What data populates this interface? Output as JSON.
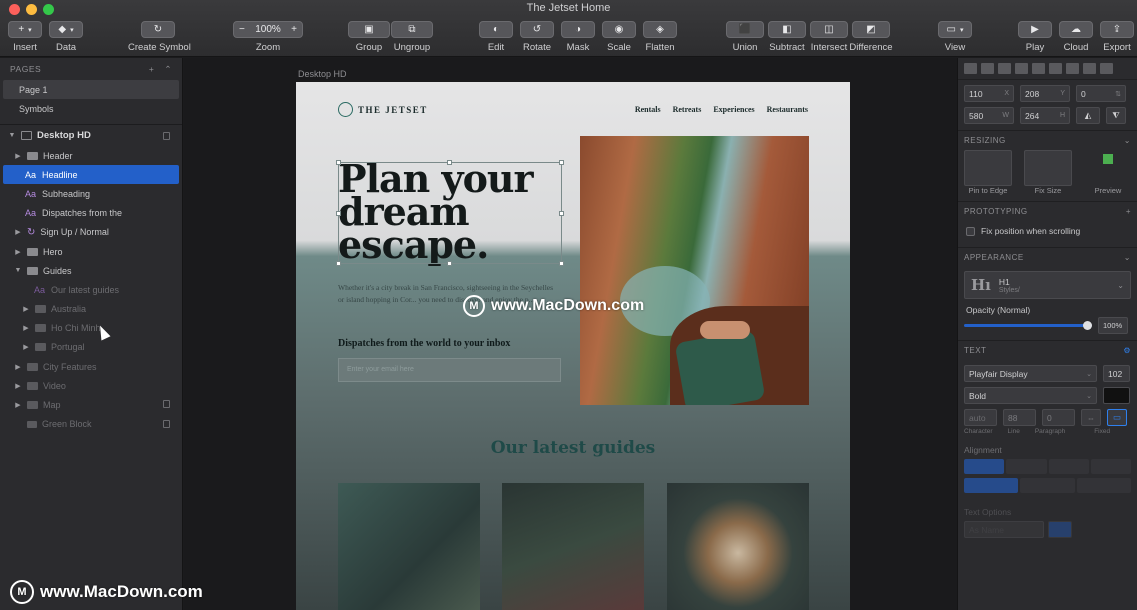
{
  "window": {
    "title": "The Jetset Home"
  },
  "toolbar": {
    "insert": "Insert",
    "data": "Data",
    "create_symbol": "Create Symbol",
    "zoom": "Zoom",
    "zoom_value": "100%",
    "zoom_minus": "−",
    "zoom_plus": "+",
    "group": "Group",
    "ungroup": "Ungroup",
    "edit": "Edit",
    "rotate": "Rotate",
    "mask": "Mask",
    "scale": "Scale",
    "flatten": "Flatten",
    "union": "Union",
    "subtract": "Subtract",
    "intersect": "Intersect",
    "difference": "Difference",
    "view": "View",
    "play": "Play",
    "cloud": "Cloud",
    "export": "Export"
  },
  "pages": {
    "heading": "PAGES",
    "items": [
      "Page 1",
      "Symbols"
    ]
  },
  "layers": {
    "artboard": "Desktop HD",
    "items": [
      {
        "label": "Header"
      },
      {
        "label": "Headline"
      },
      {
        "label": "Subheading"
      },
      {
        "label": "Dispatches from the"
      },
      {
        "label": "Sign Up / Normal"
      },
      {
        "label": "Hero"
      },
      {
        "label": "Guides"
      },
      {
        "label": "Our latest guides"
      },
      {
        "label": "Australia"
      },
      {
        "label": "Ho Chi Minh"
      },
      {
        "label": "Portugal"
      },
      {
        "label": "City Features"
      },
      {
        "label": "Video"
      },
      {
        "label": "Map"
      },
      {
        "label": "Green Block"
      }
    ]
  },
  "canvas": {
    "artboard_label": "Desktop HD",
    "logo": "THE JETSET",
    "nav": [
      "Rentals",
      "Retreats",
      "Experiences",
      "Restaurants"
    ],
    "headline": "Plan your dream escape.",
    "subheading": "Whether it's a city break in San Francisco, sightseeing in the Seychelles or island hopping in Cor... you need to discover and enjoy the p...",
    "dispatch": "Dispatches from the world to your inbox",
    "email_placeholder": "Enter your email here",
    "guides_title": "Our latest guides"
  },
  "watermark": {
    "text": "www.MacDown.com",
    "letter": "M"
  },
  "inspector": {
    "x": "110",
    "x_unit": "X",
    "y": "208",
    "y_unit": "Y",
    "rot": "0",
    "w": "580",
    "w_unit": "W",
    "h": "264",
    "h_unit": "H",
    "resizing": "RESIZING",
    "pin_to_edge": "Pin to Edge",
    "fix_size": "Fix Size",
    "preview": "Preview",
    "prototyping": "PROTOTYPING",
    "fix_position": "Fix position when scrolling",
    "appearance": "APPEARANCE",
    "style_name": "H1",
    "style_sub": "Styles/",
    "opacity_label": "Opacity (Normal)",
    "opacity_value": "100%",
    "opacity_level": 1.0,
    "text_section": "TEXT",
    "font": "Playfair Display",
    "font_size": "102",
    "weight": "Bold",
    "character_value": "auto",
    "line_value": "88",
    "paragraph_value": "0",
    "character": "Character",
    "line": "Line",
    "paragraph": "Paragraph",
    "fixed": "Fixed",
    "alignment": "Alignment",
    "text_options": "Text Options",
    "text_transform": "As Name"
  },
  "colors": {
    "selection": "#2360c9",
    "accent_teal": "#1f4a48"
  }
}
